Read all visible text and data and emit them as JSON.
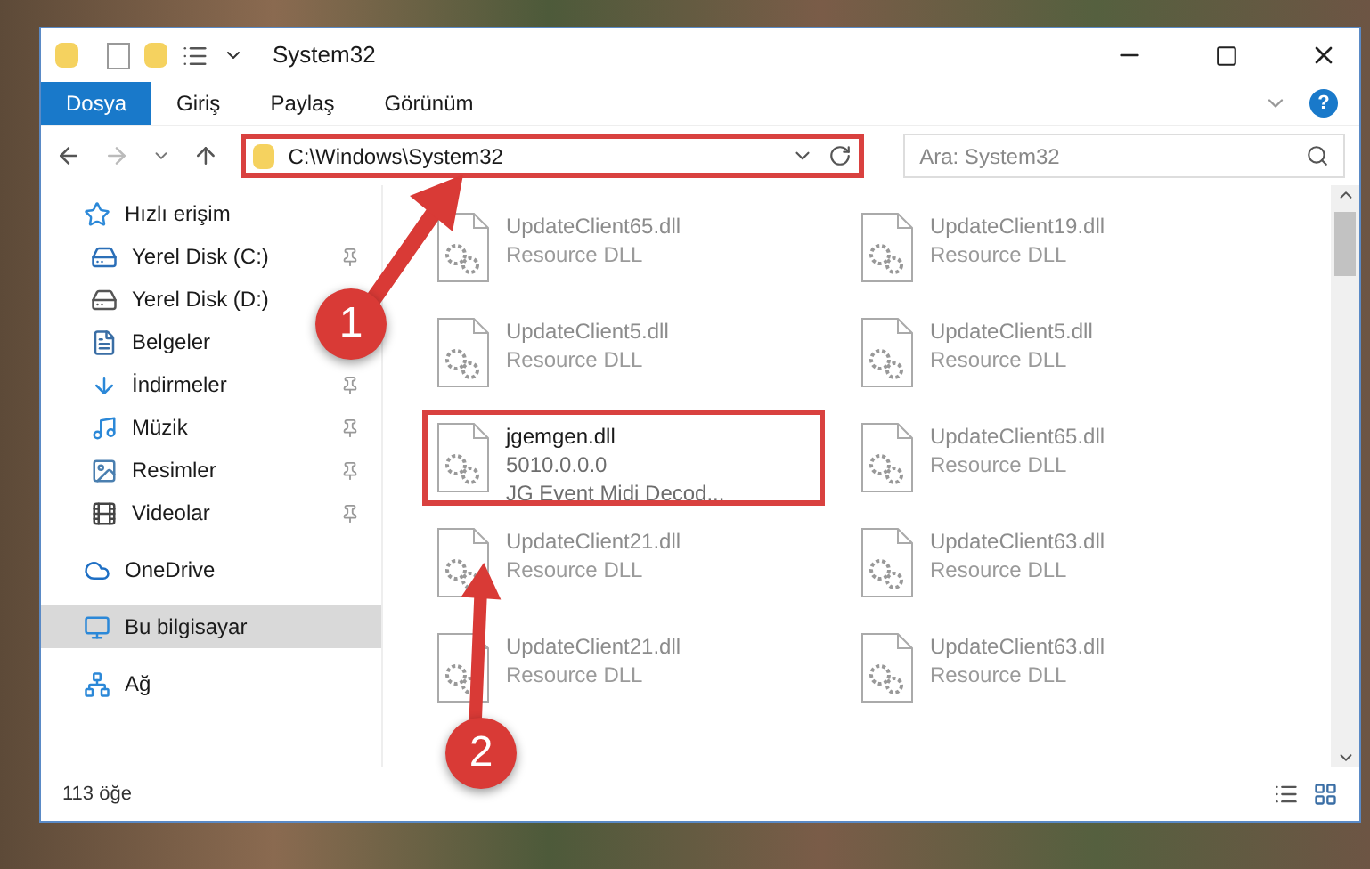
{
  "window": {
    "title": "System32"
  },
  "ribbon_tabs": [
    {
      "label": "Dosya",
      "selected": true
    },
    {
      "label": "Giriş",
      "selected": false
    },
    {
      "label": "Paylaş",
      "selected": false
    },
    {
      "label": "Görünüm",
      "selected": false
    }
  ],
  "help_button": "?",
  "address_bar": {
    "path": "C:\\Windows\\System32",
    "highlighted": true
  },
  "search": {
    "placeholder": "Ara: System32"
  },
  "sidebar": {
    "items": [
      {
        "label": "Hızlı erişim",
        "kind": "star",
        "selected": false,
        "pinned": false,
        "children": [
          {
            "label": "Yerel Disk (C:)",
            "kind": "system-drive",
            "selected": false,
            "pinned": true
          },
          {
            "label": "Yerel Disk (D:)",
            "kind": "drive",
            "selected": false,
            "pinned": false
          },
          {
            "label": "Belgeler",
            "kind": "document",
            "selected": false,
            "pinned": false
          },
          {
            "label": "İndirmeler",
            "kind": "download",
            "selected": false,
            "pinned": true
          },
          {
            "label": "Müzik",
            "kind": "music",
            "selected": false,
            "pinned": true
          },
          {
            "label": "Resimler",
            "kind": "picture",
            "selected": false,
            "pinned": true
          },
          {
            "label": "Videolar",
            "kind": "video",
            "selected": false,
            "pinned": true
          }
        ]
      },
      {
        "label": "OneDrive",
        "kind": "cloud",
        "selected": false,
        "pinned": false
      },
      {
        "label": "Bu bilgisayar",
        "kind": "monitor",
        "selected": true,
        "pinned": false
      },
      {
        "label": "Ağ",
        "kind": "network",
        "selected": false,
        "pinned": false
      }
    ]
  },
  "files": [
    {
      "name": "UpdateClient65.dll",
      "line_2": "Resource DLL",
      "highlighted": false
    },
    {
      "name": "UpdateClient19.dll",
      "line_2": "Resource DLL",
      "highlighted": false
    },
    {
      "name": "UpdateClient5.dll",
      "line_2": "Resource DLL",
      "highlighted": false
    },
    {
      "name": "UpdateClient5.dll",
      "line_2": "Resource DLL",
      "highlighted": false
    },
    {
      "name": "jgemgen.dll",
      "line_2": "5010.0.0.0",
      "line_3": "JG Event Midi Decod...",
      "highlighted": true
    },
    {
      "name": "UpdateClient65.dll",
      "line_2": "Resource DLL",
      "highlighted": false
    },
    {
      "name": "UpdateClient21.dll",
      "line_2": "Resource DLL",
      "highlighted": false
    },
    {
      "name": "UpdateClient63.dll",
      "line_2": "Resource DLL",
      "highlighted": false
    },
    {
      "name": "UpdateClient21.dll",
      "line_2": "Resource DLL",
      "highlighted": false
    },
    {
      "name": "UpdateClient63.dll",
      "line_2": "Resource DLL",
      "highlighted": false
    }
  ],
  "status_bar": {
    "item_count": "113 öğe"
  },
  "annotations": [
    {
      "number": "1"
    },
    {
      "number": "2"
    }
  ]
}
